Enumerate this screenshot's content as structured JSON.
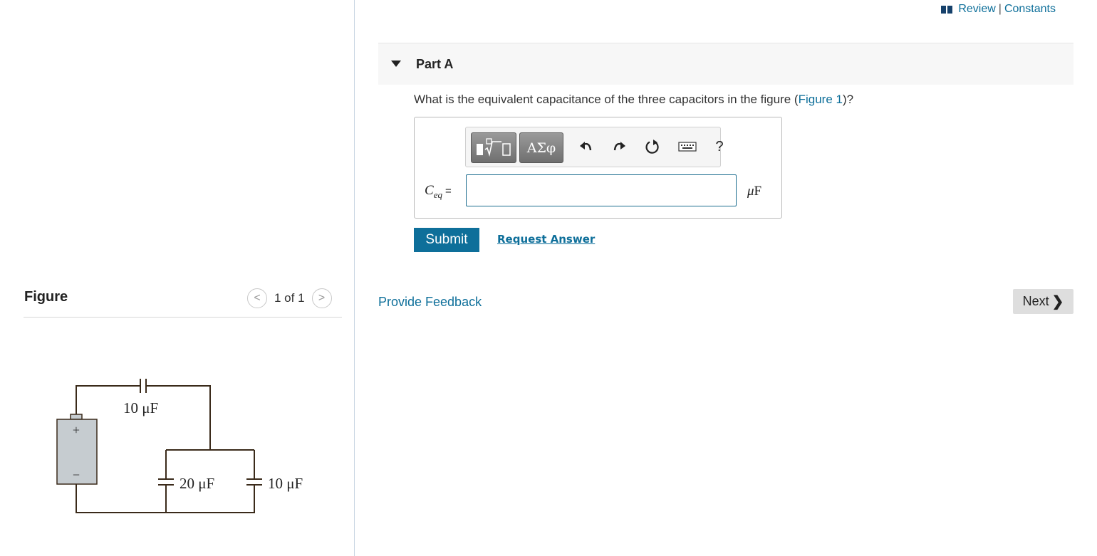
{
  "header": {
    "review_label": "Review",
    "separator": "|",
    "constants_label": "Constants"
  },
  "part": {
    "title": "Part A",
    "question_prefix": "What is the equivalent capacitance of the three capacitors in the figure (",
    "figure_link": "Figure 1",
    "question_suffix": ")?"
  },
  "toolbar": {
    "greek_label": "ΑΣφ",
    "help_label": "?",
    "icons": [
      "templates-icon",
      "greek-letters-icon",
      "undo-icon",
      "redo-icon",
      "reset-icon",
      "keyboard-icon",
      "help-icon"
    ]
  },
  "answer": {
    "variable": "C",
    "subscript": "eq",
    "equals": "=",
    "value": "",
    "unit_prefix": "μ",
    "unit": "F"
  },
  "actions": {
    "submit_label": "Submit",
    "request_label": "Request Answer",
    "feedback_label": "Provide Feedback",
    "next_label": "Next"
  },
  "figure": {
    "title": "Figure",
    "pager_text": "1 of 1",
    "circuit": {
      "top_capacitor": "10 μF",
      "left_bottom_capacitor": "20 μF",
      "right_bottom_capacitor": "10 μF",
      "battery_plus": "+",
      "battery_minus": "−"
    }
  },
  "colors": {
    "accent": "#0e6f9a",
    "toolbar_button": "#7f7f7f",
    "next_bg": "#dedede",
    "battery_fill": "#c6ccd0",
    "wire": "#3a2a1a"
  }
}
